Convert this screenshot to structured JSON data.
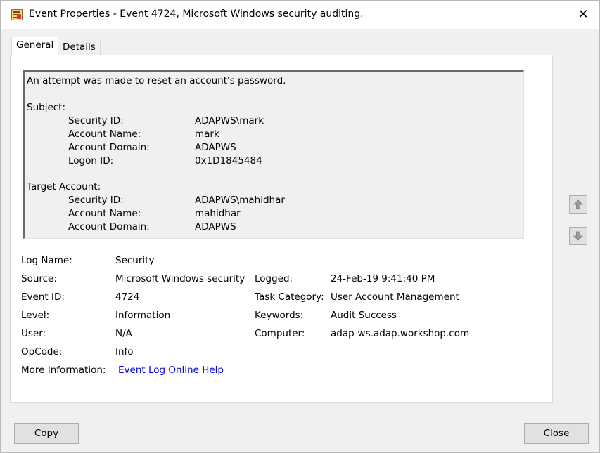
{
  "window": {
    "title": "Event Properties - Event 4724, Microsoft Windows security auditing.",
    "close_glyph": "✕",
    "icon": "event-viewer-icon"
  },
  "tabs": [
    {
      "label": "General",
      "active": true
    },
    {
      "label": "Details",
      "active": false
    }
  ],
  "description": {
    "message": "An attempt was made to reset an account's password.",
    "subject_header": "Subject:",
    "subject": [
      {
        "label": "Security ID:",
        "value": "ADAPWS\\mark"
      },
      {
        "label": "Account Name:",
        "value": "mark"
      },
      {
        "label": "Account Domain:",
        "value": "ADAPWS"
      },
      {
        "label": "Logon ID:",
        "value": "0x1D1845484"
      }
    ],
    "target_header": "Target Account:",
    "target": [
      {
        "label": "Security ID:",
        "value": "ADAPWS\\mahidhar"
      },
      {
        "label": "Account Name:",
        "value": "mahidhar"
      },
      {
        "label": "Account Domain:",
        "value": "ADAPWS"
      }
    ]
  },
  "info": {
    "log_name_label": "Log Name:",
    "log_name": "Security",
    "source_label": "Source:",
    "source": "Microsoft Windows security",
    "logged_label": "Logged:",
    "logged": "24-Feb-19 9:41:40 PM",
    "event_id_label": "Event ID:",
    "event_id": "4724",
    "task_category_label": "Task Category:",
    "task_category": "User Account Management",
    "level_label": "Level:",
    "level": "Information",
    "keywords_label": "Keywords:",
    "keywords": "Audit Success",
    "user_label": "User:",
    "user": "N/A",
    "computer_label": "Computer:",
    "computer": "adap-ws.adap.workshop.com",
    "opcode_label": "OpCode:",
    "opcode": "Info",
    "more_info_label": "More Information:",
    "more_info_link": "Event Log Online Help"
  },
  "nav": {
    "up_icon": "arrow-up-icon",
    "down_icon": "arrow-down-icon"
  },
  "buttons": {
    "copy": "Copy",
    "close": "Close"
  }
}
